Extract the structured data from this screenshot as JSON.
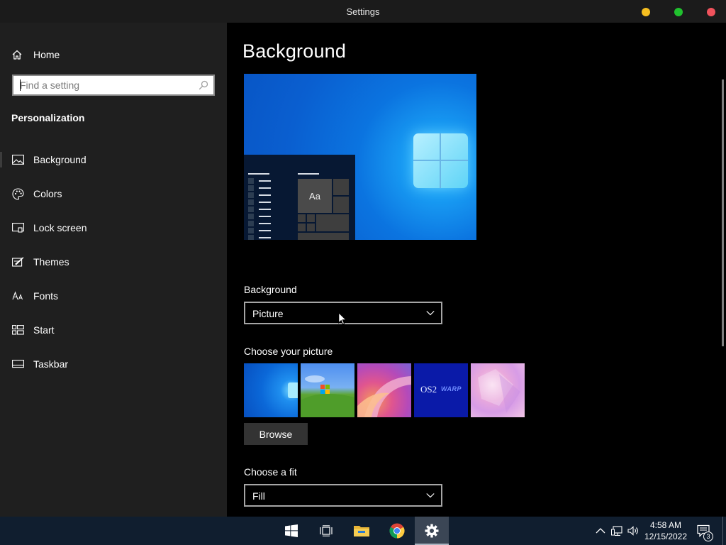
{
  "window": {
    "title": "Settings"
  },
  "sidebar": {
    "home_label": "Home",
    "search_placeholder": "Find a setting",
    "section_title": "Personalization",
    "items": [
      {
        "label": "Background",
        "icon": "picture-icon"
      },
      {
        "label": "Colors",
        "icon": "palette-icon"
      },
      {
        "label": "Lock screen",
        "icon": "lock-screen-icon"
      },
      {
        "label": "Themes",
        "icon": "themes-icon"
      },
      {
        "label": "Fonts",
        "icon": "fonts-icon"
      },
      {
        "label": "Start",
        "icon": "start-icon"
      },
      {
        "label": "Taskbar",
        "icon": "taskbar-icon"
      }
    ]
  },
  "main": {
    "title": "Background",
    "preview": {
      "tile_text": "Aa"
    },
    "background_label": "Background",
    "background_value": "Picture",
    "choose_picture_label": "Choose your picture",
    "thumbnails": [
      {
        "name": "windows-11-blue"
      },
      {
        "name": "windows-xp-bliss"
      },
      {
        "name": "windows-11-bloom"
      },
      {
        "name": "os2-warp",
        "text": "OS2",
        "text2": "WARP"
      },
      {
        "name": "pink-crystal"
      }
    ],
    "browse_label": "Browse",
    "fit_label": "Choose a fit",
    "fit_value": "Fill"
  },
  "taskbar": {
    "apps": [
      "start-icon",
      "task-view-icon",
      "file-explorer-icon",
      "chrome-icon",
      "settings-icon"
    ],
    "active_app": "settings-icon",
    "clock_time": "4:58 AM",
    "clock_date": "12/15/2022",
    "notification_count": "3"
  },
  "colors": {
    "accent": "#0a6ed8",
    "sidebar_bg": "#1f1f1f",
    "main_bg": "#000000",
    "taskbar_bg": "#101e2f"
  }
}
